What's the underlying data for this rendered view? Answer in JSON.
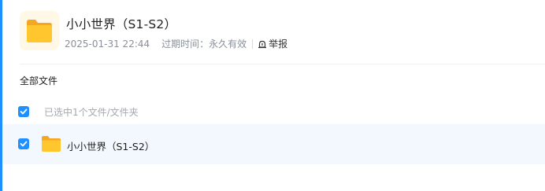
{
  "share": {
    "title": "小小世界（S1-S2）",
    "date": "2025-01-31 22:44",
    "expire_label": "过期时间：",
    "expire_value": "永久有效",
    "report_label": "举报"
  },
  "breadcrumb": {
    "label": "全部文件"
  },
  "selection": {
    "checked": true,
    "text": "已选中1个文件/文件夹"
  },
  "files": [
    {
      "name": "小小世界（S1-S2）",
      "type": "folder",
      "checked": true
    }
  ],
  "colors": {
    "accent": "#1e90ff",
    "folder": "#ffc62e",
    "row_highlight": "#f3f8fe"
  }
}
